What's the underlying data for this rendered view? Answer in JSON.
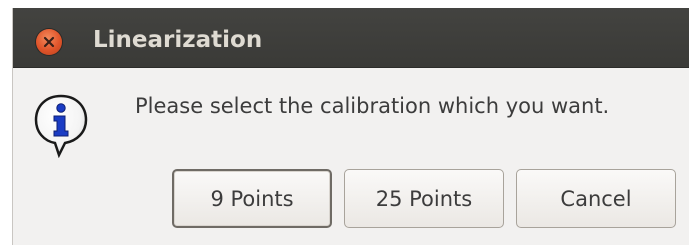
{
  "window": {
    "title": "Linearization",
    "close_icon": "close-icon"
  },
  "message": {
    "icon": "info-icon",
    "text": "Please select the calibration which you want."
  },
  "buttons": {
    "nine_points": "9 Points",
    "twenty_five_points": "25 Points",
    "cancel": "Cancel"
  },
  "colors": {
    "titlebar": "#3c3b37",
    "close_button": "#e05a2b",
    "dialog_background": "#f2f1f0",
    "info_blue": "#1a3cc4"
  }
}
